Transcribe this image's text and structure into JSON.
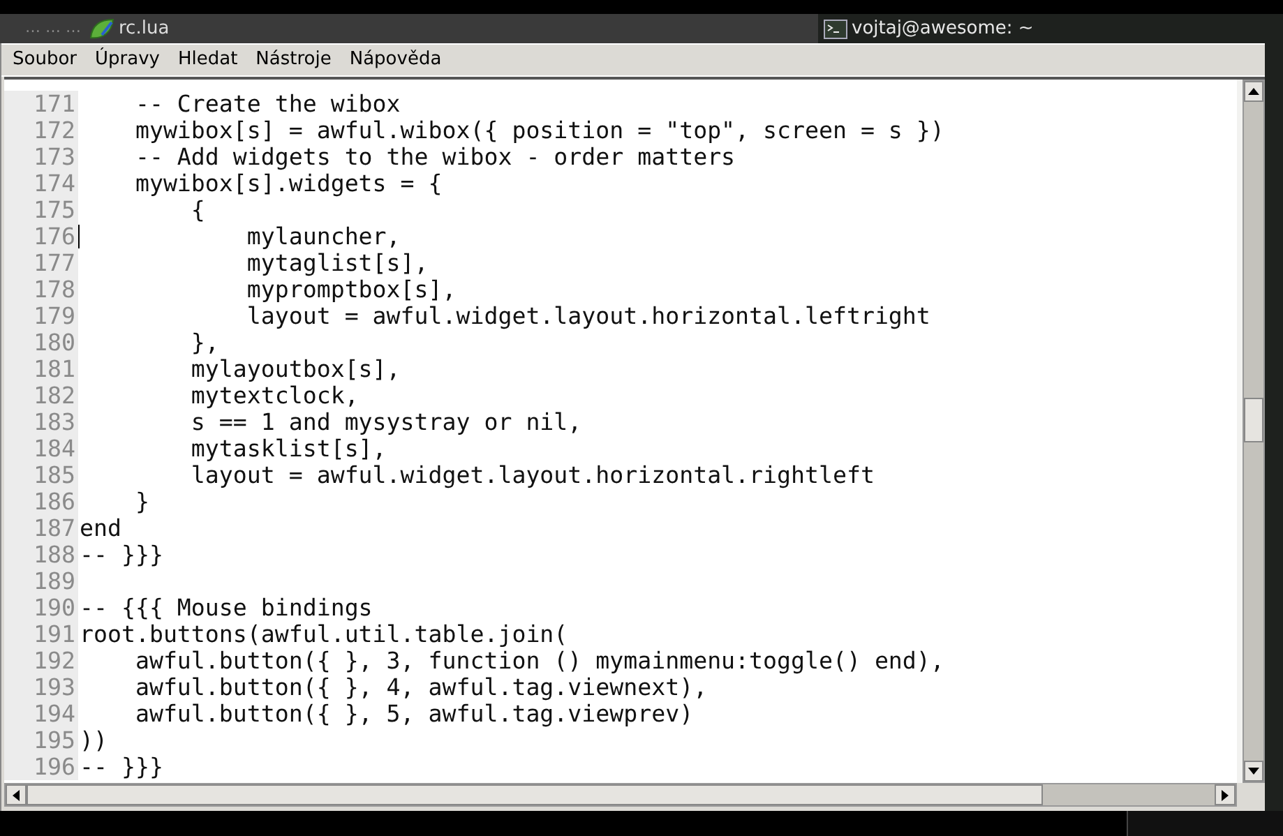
{
  "taskbar": {
    "prefix": "… … …",
    "tasks": [
      {
        "label": "rc.lua",
        "kind": "editor",
        "selected": false
      },
      {
        "label": "vojtaj@awesome: ~",
        "kind": "terminal",
        "selected": true
      }
    ]
  },
  "menu": [
    {
      "label": "Soubor"
    },
    {
      "label": "Úpravy"
    },
    {
      "label": "Hledat"
    },
    {
      "label": "Nástroje"
    },
    {
      "label": "Nápověda"
    }
  ],
  "editor": {
    "lines": [
      {
        "number": "171",
        "text": "    -- Create the wibox",
        "cursor": false
      },
      {
        "number": "172",
        "text": "    mywibox[s] = awful.wibox({ position = \"top\", screen = s })",
        "cursor": false
      },
      {
        "number": "173",
        "text": "    -- Add widgets to the wibox - order matters",
        "cursor": false
      },
      {
        "number": "174",
        "text": "    mywibox[s].widgets = {",
        "cursor": false
      },
      {
        "number": "175",
        "text": "        {",
        "cursor": false
      },
      {
        "number": "176",
        "text": "            mylauncher,",
        "cursor": true
      },
      {
        "number": "177",
        "text": "            mytaglist[s],",
        "cursor": false
      },
      {
        "number": "178",
        "text": "            mypromptbox[s],",
        "cursor": false
      },
      {
        "number": "179",
        "text": "            layout = awful.widget.layout.horizontal.leftright",
        "cursor": false
      },
      {
        "number": "180",
        "text": "        },",
        "cursor": false
      },
      {
        "number": "181",
        "text": "        mylayoutbox[s],",
        "cursor": false
      },
      {
        "number": "182",
        "text": "        mytextclock,",
        "cursor": false
      },
      {
        "number": "183",
        "text": "        s == 1 and mysystray or nil,",
        "cursor": false
      },
      {
        "number": "184",
        "text": "        mytasklist[s],",
        "cursor": false
      },
      {
        "number": "185",
        "text": "        layout = awful.widget.layout.horizontal.rightleft",
        "cursor": false
      },
      {
        "number": "186",
        "text": "    }",
        "cursor": false
      },
      {
        "number": "187",
        "text": "end",
        "cursor": false
      },
      {
        "number": "188",
        "text": "-- }}}",
        "cursor": false
      },
      {
        "number": "189",
        "cursor": false
      },
      {
        "number": "190",
        "text": "-- {{{ Mouse bindings",
        "cursor": false
      },
      {
        "number": "191",
        "text": "root.buttons(awful.util.table.join(",
        "cursor": false
      },
      {
        "number": "192",
        "text": "    awful.button({ }, 3, function () mymainmenu:toggle() end),",
        "cursor": false
      },
      {
        "number": "193",
        "text": "    awful.button({ }, 4, awful.tag.viewnext),",
        "cursor": false
      },
      {
        "number": "194",
        "text": "    awful.button({ }, 5, awful.tag.viewprev)",
        "cursor": false
      },
      {
        "number": "195",
        "text": "))",
        "cursor": false
      },
      {
        "number": "196",
        "text": "-- }}}",
        "cursor": false
      }
    ]
  }
}
